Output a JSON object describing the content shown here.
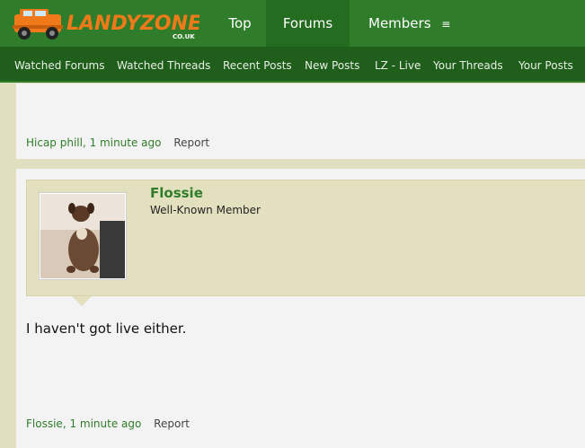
{
  "brand": {
    "logo_text": "LANDYZONE",
    "logo_sub": "CO.UK",
    "colors": {
      "header": "#2f7d2a",
      "subnav": "#1f5e1b",
      "accent_text": "#2f7d2a",
      "logo_orange": "#f07a1a"
    }
  },
  "nav": {
    "tabs": [
      {
        "label": "Top"
      },
      {
        "label": "Forums"
      },
      {
        "label": "Members",
        "icon": "menu-icon"
      }
    ],
    "menu_glyph": "≡"
  },
  "subnav": {
    "items": [
      {
        "label": "Watched Forums"
      },
      {
        "label": "Watched Threads"
      },
      {
        "label": "Recent Posts"
      },
      {
        "label": "New Posts"
      },
      {
        "label": "LZ - Live"
      },
      {
        "label": "Your Threads"
      },
      {
        "label": "Your Posts"
      }
    ]
  },
  "posts": [
    {
      "author": "Hicap phill",
      "time": ", 1 minute ago",
      "report": "Report"
    },
    {
      "username": "Flossie",
      "user_title": "Well-Known Member",
      "avatar": "dog-avatar-icon",
      "message": "I haven't got live either.",
      "author": "Flossie",
      "time": ", 1 minute ago",
      "report": "Report"
    }
  ]
}
